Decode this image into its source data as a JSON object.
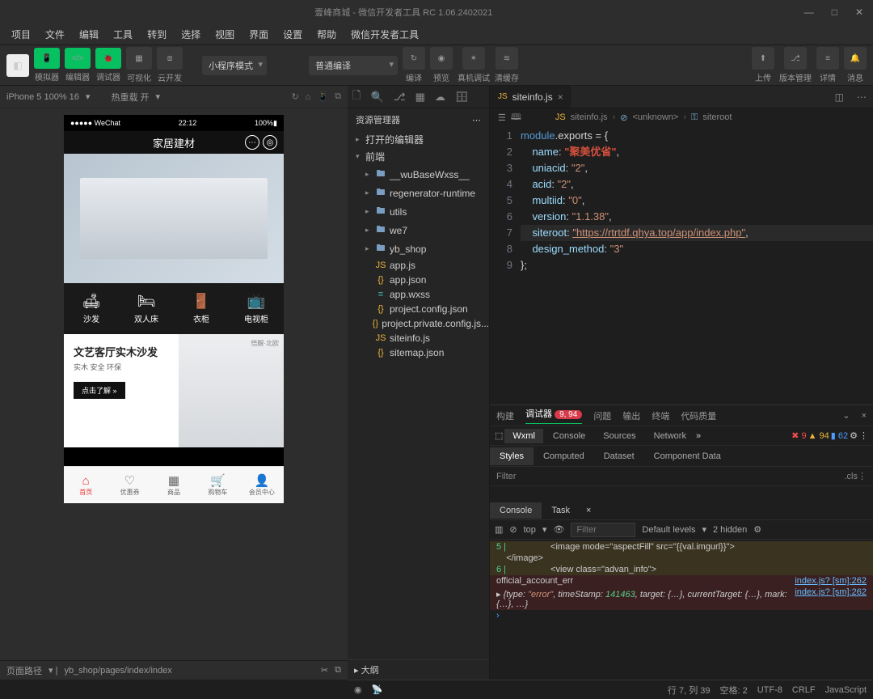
{
  "title": "壹峰商城 - 微信开发者工具 RC 1.06.2402021",
  "menu": [
    "项目",
    "文件",
    "编辑",
    "工具",
    "转到",
    "选择",
    "视图",
    "界面",
    "设置",
    "帮助",
    "微信开发者工具"
  ],
  "toolbar": {
    "groups": [
      "模拟器",
      "编辑器",
      "调试器",
      "可视化",
      "云开发"
    ],
    "mode": "小程序模式",
    "compile": "普通编译",
    "center": [
      "编译",
      "预览",
      "真机调试",
      "清缓存"
    ],
    "right": [
      "上传",
      "版本管理",
      "详情",
      "消息"
    ]
  },
  "sim": {
    "device": "iPhone 5 100% 16",
    "hot": "热重载 开"
  },
  "phone": {
    "carrier": "●●●●● WeChat",
    "time": "22:12",
    "batt": "100%",
    "title": "家居建材",
    "cats": [
      "沙发",
      "双人床",
      "衣柜",
      "电视柜"
    ],
    "prod": {
      "t1": "文艺客厅实木沙发",
      "t2": "实木  安全  环保",
      "btn": "点击了解 »",
      "rtag": "悟醒·北欧"
    },
    "tabs": [
      "首页",
      "优惠券",
      "商品",
      "购物车",
      "会员中心"
    ]
  },
  "explorer": {
    "hdr": "资源管理器",
    "open": "打开的编辑器",
    "root": "前端",
    "items": [
      {
        "t": "fold",
        "n": "__wuBaseWxss__"
      },
      {
        "t": "fold",
        "n": "regenerator-runtime"
      },
      {
        "t": "fold",
        "n": "utils"
      },
      {
        "t": "fold",
        "n": "we7"
      },
      {
        "t": "fold",
        "n": "yb_shop"
      },
      {
        "t": "js",
        "n": "app.js"
      },
      {
        "t": "json",
        "n": "app.json"
      },
      {
        "t": "wxss",
        "n": "app.wxss"
      },
      {
        "t": "json",
        "n": "project.config.json"
      },
      {
        "t": "json",
        "n": "project.private.config.js..."
      },
      {
        "t": "js",
        "n": "siteinfo.js"
      },
      {
        "t": "json",
        "n": "sitemap.json"
      }
    ],
    "outline": "大纲"
  },
  "editor": {
    "tab": "siteinfo.js",
    "crumb": [
      "siteinfo.js",
      "<unknown>",
      "siteroot"
    ],
    "lines": [
      1,
      2,
      3,
      4,
      5,
      6,
      7,
      8,
      9
    ],
    "code": {
      "l1_a": "module",
      "l1_b": ".exports = ",
      "l1_c": "{",
      "l2_k": "name",
      "l2_v": "\"聚美优省\"",
      "l3_k": "uniacid",
      "l3_v": "\"2\"",
      "l4_k": "acid",
      "l4_v": "\"2\"",
      "l5_k": "multiid",
      "l5_v": "\"0\"",
      "l6_k": "version",
      "l6_v": "\"1.1.38\"",
      "l7_k": "siteroot",
      "l7_v": "\"https://rtrtdf.qhya.top/app/index.php\"",
      "l8_k": "design_method",
      "l8_v": "\"3\"",
      "l9": "};"
    }
  },
  "bottom": {
    "tabs": [
      "构建",
      "调试器",
      "问题",
      "输出",
      "终端",
      "代码质量"
    ],
    "badge": "9, 94",
    "dev": [
      "Wxml",
      "Console",
      "Sources",
      "Network"
    ],
    "errs": "9",
    "warns": "94",
    "infos": "62",
    "style": [
      "Styles",
      "Computed",
      "Dataset",
      "Component Data"
    ],
    "filter": "Filter",
    "cls": ".cls",
    "cons": [
      "Console",
      "Task"
    ],
    "top": "top",
    "filter2": "Filter",
    "levels": "Default levels",
    "hidden": "2 hidden",
    "out": {
      "a5": "5 |",
      "a_img": "<image mode=\"aspectFill\" src=\"{{val.imgurl}}\">",
      "a_imgc": "</image>",
      "a6": "6 |",
      "a_view": "<view class=\"advan_info\">",
      "err": "official_account_err",
      "link": "index.js? [sm]:262",
      "obj_a": "{type: ",
      "obj_b": "\"error\"",
      "obj_c": ", timeStamp: ",
      "obj_d": "141463",
      "obj_e": ", target: {…}, currentTarget: {…}, mark: {…}, …}"
    }
  },
  "status": {
    "path": "页面路径",
    "route": "yb_shop/pages/index/index",
    "pos": "行 7, 列 39",
    "spaces": "空格: 2",
    "enc": "UTF-8",
    "eol": "CRLF",
    "lang": "JavaScript"
  }
}
